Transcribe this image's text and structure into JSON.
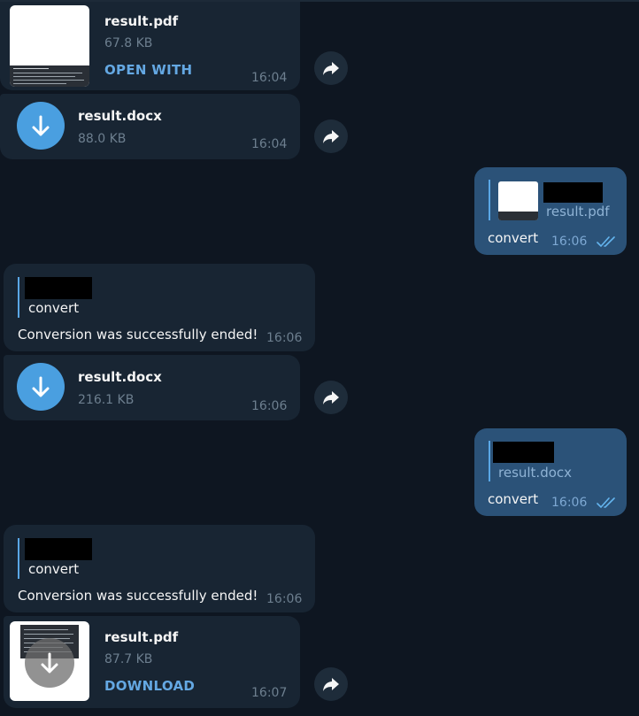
{
  "messages": {
    "m1": {
      "file_name": "result.pdf",
      "file_size": "67.8 KB",
      "action": "OPEN WITH",
      "time": "16:04"
    },
    "m2": {
      "file_name": "result.docx",
      "file_size": "88.0 KB",
      "time": "16:04"
    },
    "m3": {
      "reply_file": "result.pdf",
      "text": "convert",
      "time": "16:06",
      "status": "read"
    },
    "m4": {
      "reply_text": "convert",
      "text": "Conversion was successfully ended!",
      "time": "16:06"
    },
    "m5": {
      "file_name": "result.docx",
      "file_size": "216.1 KB",
      "time": "16:06"
    },
    "m6": {
      "reply_file": "result.docx",
      "text": "convert",
      "time": "16:06",
      "status": "read"
    },
    "m7": {
      "reply_text": "convert",
      "text": "Conversion was successfully ended!",
      "time": "16:06"
    },
    "m8": {
      "file_name": "result.pdf",
      "file_size": "87.7 KB",
      "action": "DOWNLOAD",
      "time": "16:07"
    }
  },
  "icons": {
    "download": "arrow-down-icon",
    "forward": "forward-arrow-icon",
    "read_receipt": "double-check-icon"
  },
  "colors": {
    "background": "#0e1621",
    "incoming_bubble": "#182533",
    "outgoing_bubble": "#2b5278",
    "accent": "#64a8e3",
    "download_circle": "#4a9fe0"
  }
}
